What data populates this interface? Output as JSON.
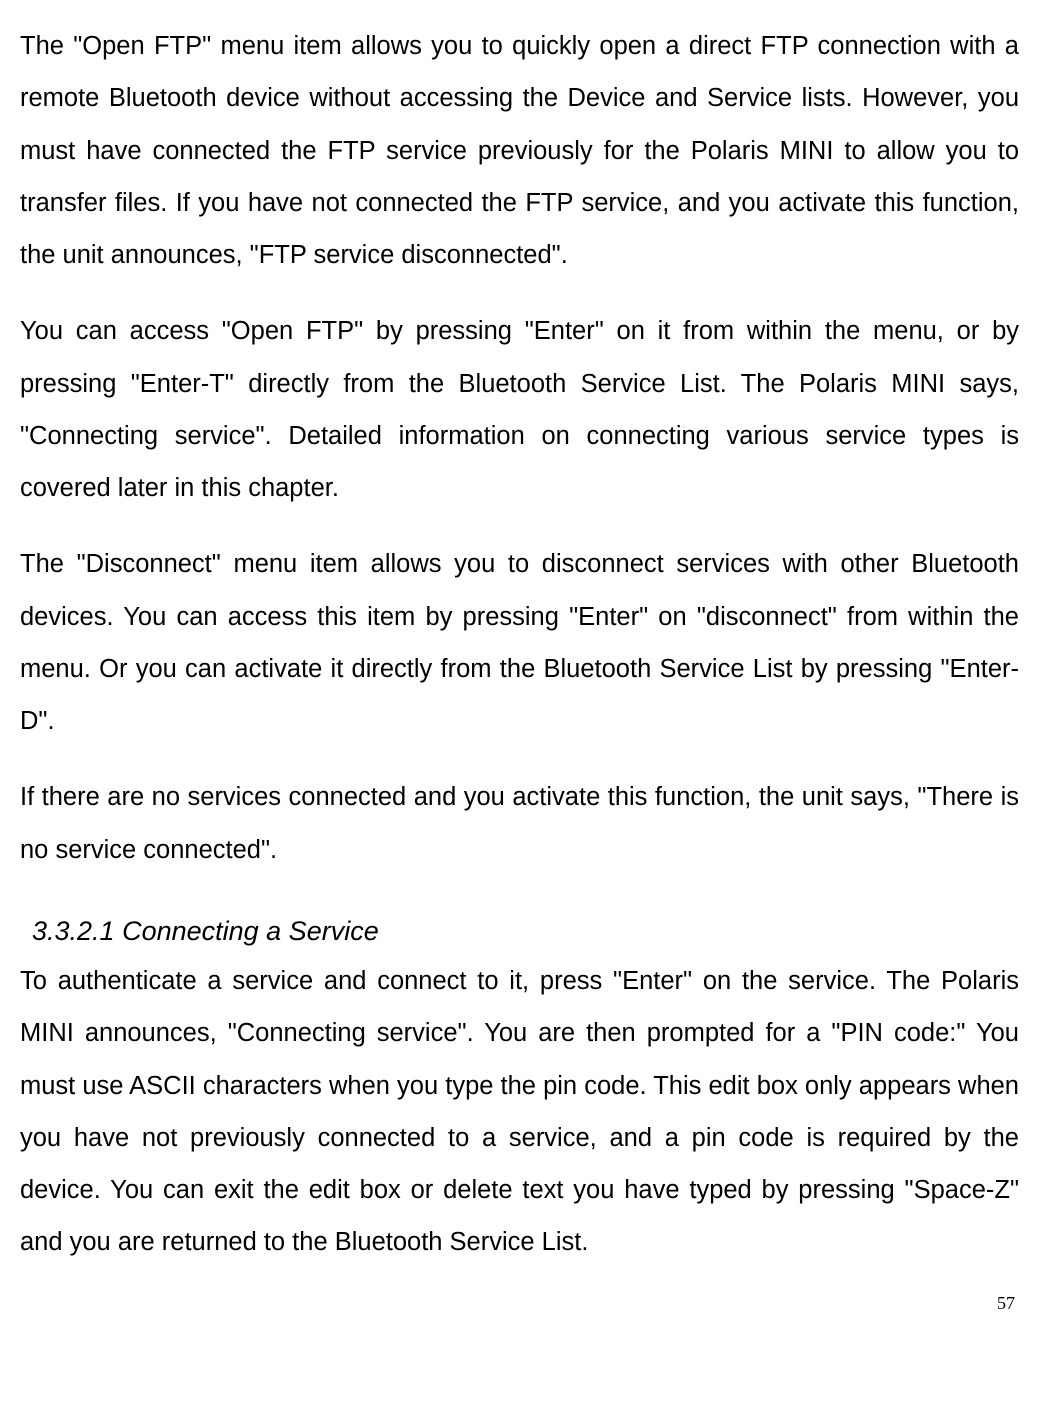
{
  "paragraphs": {
    "p1": "The \"Open FTP\" menu item allows you to quickly open a direct FTP connection with a remote Bluetooth device without accessing the Device and Service lists. However, you must have connected the FTP service previously for the Polaris MINI to allow you to transfer files. If you have not connected the FTP service, and you activate this function, the unit announces, \"FTP service disconnected\".",
    "p2": "You can access \"Open FTP\" by pressing \"Enter\" on it from within the menu, or by pressing \"Enter-T\" directly from the Bluetooth Service List. The Polaris MINI says, \"Connecting service\". Detailed information on connecting various service types is covered later in this chapter.",
    "p3": "The \"Disconnect\" menu item allows you to disconnect services with other Bluetooth devices. You can access this item by pressing \"Enter\" on \"disconnect\" from within the menu. Or you can activate it directly from the Bluetooth Service List by pressing \"Enter-D\".",
    "p4": "If there are no services connected and you activate this function, the unit says, \"There is no service connected\".",
    "p5": "To authenticate a service and connect to it, press \"Enter\" on the service. The Polaris MINI announces, \"Connecting service\". You are then prompted for a \"PIN code:\" You must use ASCII characters when you type the pin code. This edit box only appears when you have not previously connected to a service, and a pin code is required by the device. You can exit the edit box or delete text you have typed by pressing \"Space-Z\" and you are returned to the Bluetooth Service List."
  },
  "heading": "3.3.2.1 Connecting a Service",
  "page_number": "57"
}
